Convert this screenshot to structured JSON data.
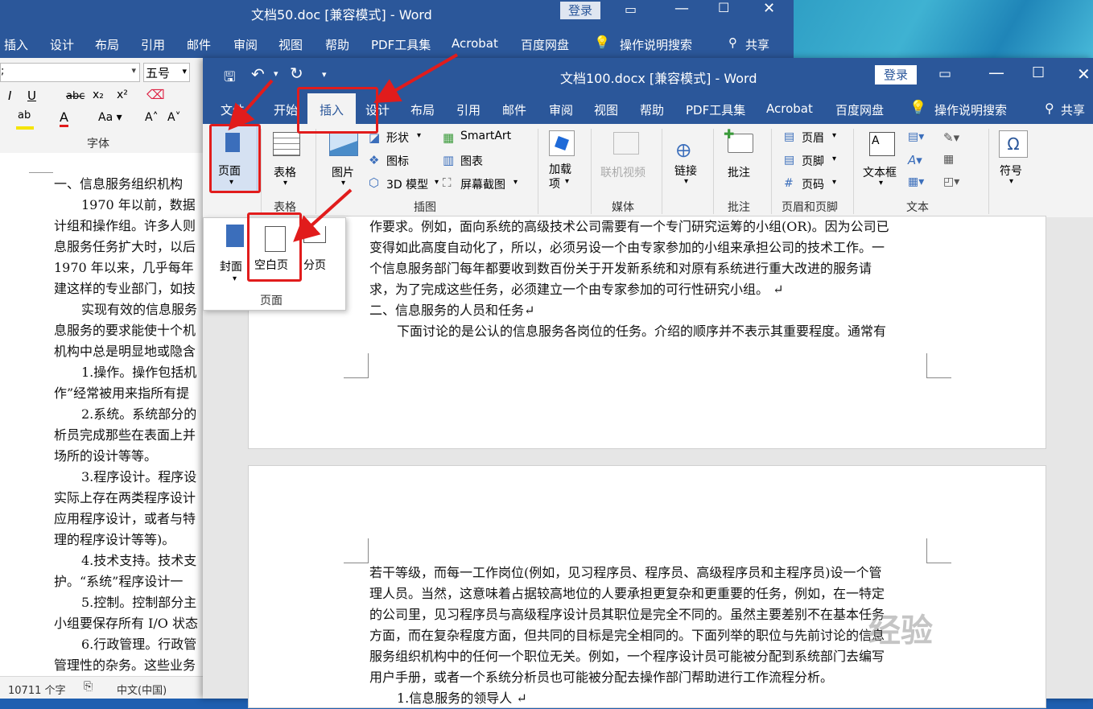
{
  "background_window": {
    "title": "文档50.doc [兼容模式] - Word",
    "login": "登录",
    "tabs": [
      "插入",
      "设计",
      "布局",
      "引用",
      "邮件",
      "审阅",
      "视图",
      "帮助",
      "PDF工具集",
      "Acrobat",
      "百度网盘",
      "操作说明搜索",
      "共享"
    ],
    "font_size": "五号",
    "font_group_label": "字体",
    "doc_lines": [
      "一、信息服务组织机构",
      "1970 年以前，数据",
      "计组和操作组。许多人则",
      "息服务任务扩大时，以后",
      "1970 年以来，几乎每年",
      "建这样的专业部门，如技",
      "实现有效的信息服务",
      "息服务的要求能使十个机",
      "机构中总是明显地或隐含",
      "1.操作。操作包括机",
      "作”经常被用来指所有提",
      "2.系统。系统部分的",
      "析员完成那些在表面上并",
      "场所的设计等等。",
      "3.程序设计。程序设",
      "实际上存在两类程序设计",
      "应用程序设计，或者与特",
      "理的程序设计等等)。",
      "4.技术支持。技术支",
      "护。“系统”程序设计一",
      "5.控制。控制部分主",
      "小组要保存所有 I/O 状态",
      "6.行政管理。行政管",
      "管理性的杂务。这些业务"
    ],
    "status_words": "10711 个字",
    "status_lang": "中文(中国)"
  },
  "window": {
    "title": "文档100.docx [兼容模式] - Word",
    "login": "登录",
    "tabs": [
      "文件",
      "开始",
      "插入",
      "设计",
      "布局",
      "引用",
      "邮件",
      "审阅",
      "视图",
      "帮助",
      "PDF工具集",
      "Acrobat",
      "百度网盘"
    ],
    "search": "操作说明搜索",
    "share": "共享"
  },
  "ribbon": {
    "pages": "页面",
    "table": "表格",
    "pictures": "图片",
    "shapes": "形状",
    "icons": "图标",
    "model3d": "3D 模型",
    "smartart": "SmartArt",
    "chart": "图表",
    "screenshot": "屏幕截图",
    "addins_1": "加载",
    "addins_2": "项",
    "online_video": "联机视频",
    "link": "链接",
    "comment": "批注",
    "header": "页眉",
    "footer": "页脚",
    "page_number": "页码",
    "textbox": "文本框",
    "symbol": "符号",
    "group_table": "表格",
    "group_illustrations": "插图",
    "group_media": "媒体",
    "group_comments": "批注",
    "group_header_footer": "页眉和页脚",
    "group_text": "文本"
  },
  "dropdown": {
    "cover": "封面",
    "blank": "空白页",
    "page_break": "分页",
    "group": "页面"
  },
  "page1_lines": [
    "作要求。例如，面向系统的高级技术公司需要有一个专门研究运筹的小组(OR)。因为公司已",
    "变得如此高度自动化了，所以，必须另设一个由专家参加的小组来承担公司的技术工作。一",
    "个信息服务部门每年都要收到数百份关于开发新系统和对原有系统进行重大改进的服务请",
    "求，为了完成这些任务，必须建立一个由专家参加的可行性研究小组。 ↵",
    "二、信息服务的人员和任务↵",
    "下面讨论的是公认的信息服务各岗位的任务。介绍的顺序并不表示其重要程度。通常有"
  ],
  "page2_lines": [
    "若干等级，而每一工作岗位(例如，见习程序员、程序员、高级程序员和主程序员)设一个管",
    "理人员。当然，这意味着占据较高地位的人要承担更复杂和更重要的任务，例如，在一特定",
    "的公司里，见习程序员与高级程序设计员其职位是完全不同的。虽然主要差别不在基本任务",
    "方面，而在复杂程度方面，但共同的目标是完全相同的。下面列举的职位与先前讨论的信息",
    "服务组织机构中的任何一个职位无关。例如，一个程序设计员可能被分配到系统部门去编写",
    "用户手册，或者一个系统分析员也可能被分配去操作部门帮助进行工作流程分析。",
    "1.信息服务的领导人 ↵"
  ],
  "watermark": "经验"
}
